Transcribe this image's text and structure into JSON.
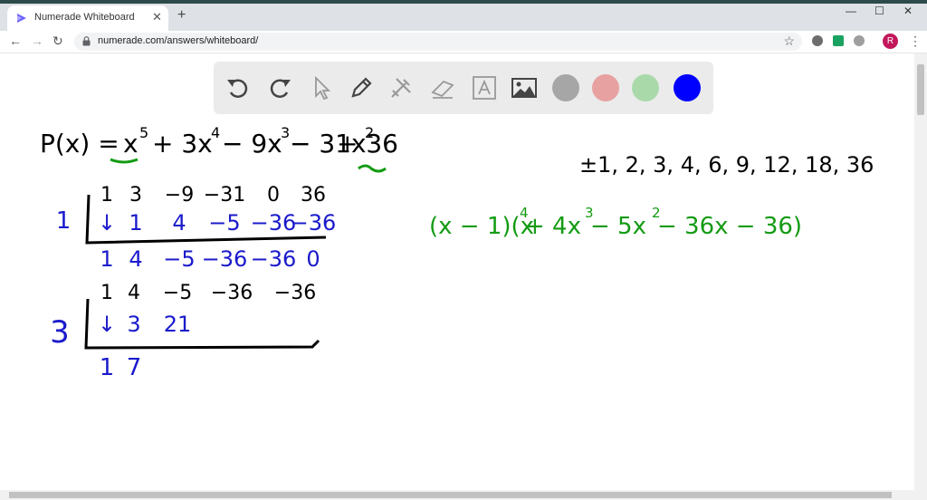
{
  "browser": {
    "tab_title": "Numerade Whiteboard",
    "tab_close": "✕",
    "new_tab": "+",
    "window_buttons": {
      "minimize": "—",
      "maximize": "☐",
      "close": "✕"
    },
    "nav": {
      "back": "←",
      "forward": "→",
      "reload": "↻"
    },
    "url": "numerade.com/answers/whiteboard/",
    "bookmark_star": "☆",
    "profile_initial": "R",
    "menu": "⋮"
  },
  "whiteboard": {
    "tools": [
      "undo-icon",
      "redo-icon",
      "select-icon",
      "pen-icon",
      "tools-icon",
      "eraser-icon",
      "text-icon",
      "image-icon"
    ],
    "colors": [
      "#a6a6a6",
      "#e8a1a1",
      "#a9d9a9",
      "#0000ff"
    ],
    "ink_colors": {
      "black": "#000000",
      "blue": "#1a1acc",
      "green": "#139b13"
    },
    "polynomial": {
      "label": "P(x) =",
      "terms": [
        "x",
        "5",
        "+ 3x",
        "4",
        "− 9x",
        "3",
        "− 31x",
        "2",
        "+ 36"
      ]
    },
    "possible_roots": "±1, 2, 3, 4, 6, 9, 12, 18, 36",
    "division_1": {
      "divisor": "1",
      "coefficients": [
        "1",
        "3",
        "−9",
        "−31",
        "0",
        "36"
      ],
      "products": [
        "↓",
        "1",
        "4",
        "−5",
        "−36",
        "−36"
      ],
      "results": [
        "1",
        "4",
        "−5",
        "−36",
        "−36",
        "0"
      ]
    },
    "division_2": {
      "divisor": "3",
      "coefficients": [
        "1",
        "4",
        "−5",
        "−36",
        "−36"
      ],
      "products": [
        "↓",
        "3",
        "21"
      ],
      "results": [
        "1",
        "7"
      ]
    },
    "factored": {
      "parts": [
        "(x − 1)(x",
        "4",
        " + 4x",
        "3",
        " − 5x",
        "2",
        " − 36x − 36)"
      ]
    }
  }
}
